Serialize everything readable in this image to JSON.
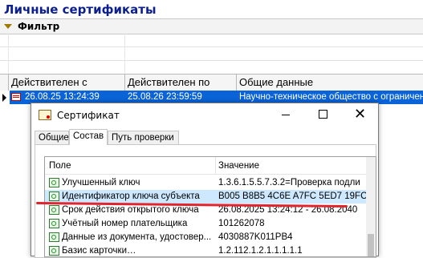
{
  "app": {
    "title": "Личные сертификаты"
  },
  "filter": {
    "label": "Фильтр"
  },
  "grid": {
    "headers": [
      "Действителен с",
      "Действителен по",
      "Общие данные"
    ],
    "row": {
      "valid_from": "26.08.25 13:24:39",
      "valid_to": "25.08.26 23:59:59",
      "general": "Научно-техническое общество с ограниченн"
    }
  },
  "dialog": {
    "title": "Сертификат",
    "tabs": [
      "Общие",
      "Состав",
      "Путь проверки"
    ],
    "active_tab": "Состав",
    "list": {
      "headers": {
        "field": "Поле",
        "value": "Значение"
      },
      "items": [
        {
          "field": "Улучшенный ключ",
          "value": "1.3.6.1.5.5.7.3.2=Проверка подли",
          "selected": false
        },
        {
          "field": "Идентификатор ключа субъекта",
          "value": "B005 B8B5 4C6E A7FC 5ED7 19FC",
          "selected": true
        },
        {
          "field": "Срок действия открытого ключа",
          "value": "26.08.2025 13:24:12 - 26.08.2040",
          "selected": false
        },
        {
          "field": "Учётный номер плательщика",
          "value": "101262078",
          "selected": false
        },
        {
          "field": "Данные из документа, удостовер...",
          "value": "4030887K011PB4",
          "selected": false
        },
        {
          "field": "Базис карточки…",
          "value": "1.2.112.1.2.1.1.1.1.1",
          "selected": false
        }
      ]
    }
  },
  "colors": {
    "title_blue": "#0b1f8f",
    "selection_blue": "#0a64d8",
    "list_selected": "#cde8ff",
    "annotation_red": "#e1252f"
  }
}
